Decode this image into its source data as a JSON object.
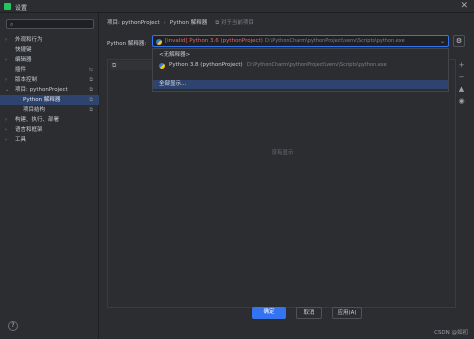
{
  "window": {
    "title": "设置",
    "close_glyph": "✕"
  },
  "sidebar": {
    "search_placeholder": "",
    "items": [
      {
        "label": "外观和行为",
        "chev": "›",
        "icon": ""
      },
      {
        "label": "快捷键",
        "chev": "",
        "icon": ""
      },
      {
        "label": "编辑器",
        "chev": "›",
        "icon": ""
      },
      {
        "label": "插件",
        "chev": "",
        "icon": "⇆"
      },
      {
        "label": "版本控制",
        "chev": "›",
        "icon": "⧉"
      },
      {
        "label": "项目: pythonProject",
        "chev": "⌄",
        "icon": "⧉"
      },
      {
        "label": "Python 解释器",
        "chev": "",
        "icon": "⧉"
      },
      {
        "label": "项目结构",
        "chev": "",
        "icon": "⧉"
      },
      {
        "label": "构建、执行、部署",
        "chev": "›",
        "icon": ""
      },
      {
        "label": "语言和框架",
        "chev": "›",
        "icon": ""
      },
      {
        "label": "工具",
        "chev": "›",
        "icon": ""
      }
    ],
    "help_glyph": "?"
  },
  "breadcrumb": {
    "project": "项目: pythonProject",
    "separator": "›",
    "page": "Python 解释器",
    "note": "⧉ 对于当前项目"
  },
  "interpreter": {
    "label": "Python 解释器:",
    "selected_name": "[invalid] Python 3.6 (pythonProject)",
    "selected_path": "D:\\PythonCharm\\pythonProject\\venv\\Scripts\\python.exe"
  },
  "dropdown": {
    "no_interpreter": "<无解释器>",
    "option_name": "Python 3.8 (pythonProject)",
    "option_path": "D:\\PythonCharm\\pythonProject\\venv\\Scripts\\python.exe",
    "show_all": "全部显示..."
  },
  "packages": {
    "empty_text": "没有显示"
  },
  "footer": {
    "ok": "确定",
    "cancel": "取消",
    "apply": "应用(A)"
  },
  "watermark": "CSDN @如初",
  "colors": {
    "accent": "#3574f0",
    "invalid": "#e06c6c",
    "selected_bg": "#2e436e"
  }
}
